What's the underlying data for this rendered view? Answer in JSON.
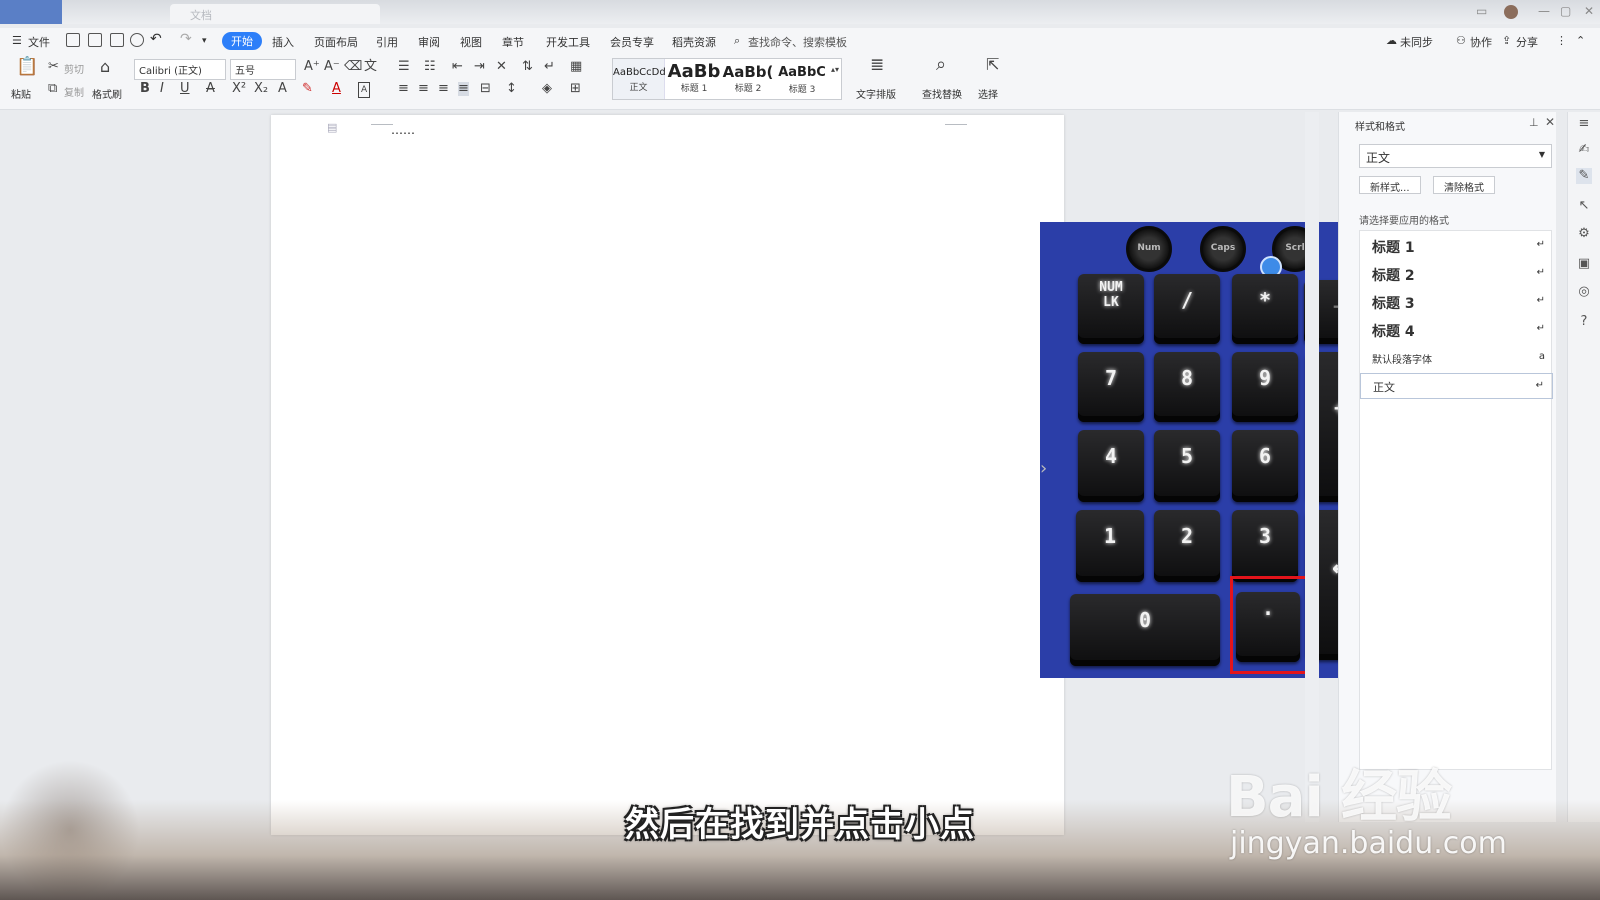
{
  "menubar": {
    "file": "文件",
    "tabs": [
      "开始",
      "插入",
      "页面布局",
      "引用",
      "审阅",
      "视图",
      "章节",
      "开发工具",
      "会员专享",
      "稻壳资源"
    ],
    "search_placeholder": "查找命令、搜索模板",
    "right": {
      "sync": "未同步",
      "collab": "协作",
      "share": "分享"
    }
  },
  "ribbon": {
    "paste": "粘贴",
    "cut": "剪切",
    "copy": "复制",
    "format_painter": "格式刷",
    "font_name": "Calibri (正文)",
    "font_size": "五号",
    "styles": [
      {
        "preview": "AaBbCcDd",
        "label": "正文"
      },
      {
        "preview": "AaBb",
        "label": "标题 1"
      },
      {
        "preview": "AaBb(",
        "label": "标题 2"
      },
      {
        "preview": "AaBbC",
        "label": "标题 3"
      }
    ],
    "text_layout": "文字排版",
    "find_replace": "查找替换",
    "select": "选择"
  },
  "document": {
    "text": "……"
  },
  "photo": {
    "knobs": [
      "Num",
      "Caps",
      "Scrl"
    ],
    "keys": {
      "numlk": "NUM\nLK",
      "slash": "/",
      "star": "*",
      "minus": "−",
      "k7": "7",
      "k8": "8",
      "k9": "9",
      "plus": "+",
      "k4": "4",
      "k5": "5",
      "k6": "6",
      "k1": "1",
      "k2": "2",
      "k3": "3",
      "enter": "↵",
      "k0": "0",
      "dot": "."
    }
  },
  "pane": {
    "title": "样式和格式",
    "current_style": "正文",
    "new_style": "新样式...",
    "clear_format": "清除格式",
    "hint": "请选择要应用的格式",
    "items": [
      {
        "label": "标题  1",
        "mark": "↵"
      },
      {
        "label": "标题  2",
        "mark": "↵"
      },
      {
        "label": "标题  3",
        "mark": "↵"
      },
      {
        "label": "标题  4",
        "mark": "↵"
      },
      {
        "label": "默认段落字体",
        "mark": "a"
      },
      {
        "label": "正文",
        "mark": "↵"
      }
    ]
  },
  "overlay": {
    "subtitle": "然后在找到并点击小点",
    "watermark_logo": "Bai 经验",
    "watermark_url": "jingyan.baidu.com"
  }
}
